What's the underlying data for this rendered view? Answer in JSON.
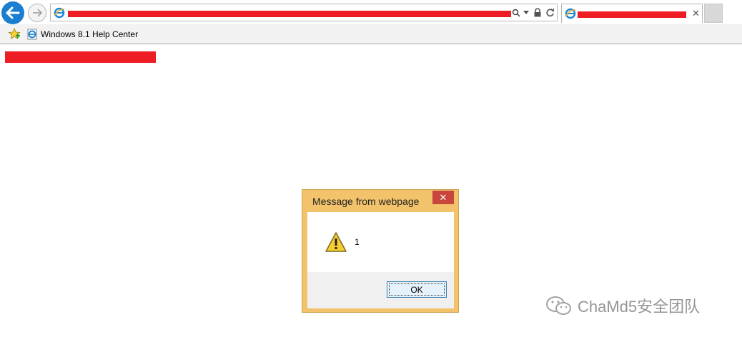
{
  "browser": {
    "favorites_bar": {
      "items": [
        {
          "label": "Windows 8.1 Help Center",
          "icon": "ie-page-icon"
        }
      ]
    }
  },
  "dialog": {
    "title": "Message from webpage",
    "message": "1",
    "ok_label": "OK",
    "close_glyph": "✕",
    "icon": "warning-icon"
  },
  "watermark": {
    "text": "ChaMd5安全团队"
  },
  "colors": {
    "back_button": "#1b7fd1",
    "dialog_frame": "#f2c36a",
    "dialog_close": "#c9463d",
    "redaction": "#ee1c25"
  }
}
